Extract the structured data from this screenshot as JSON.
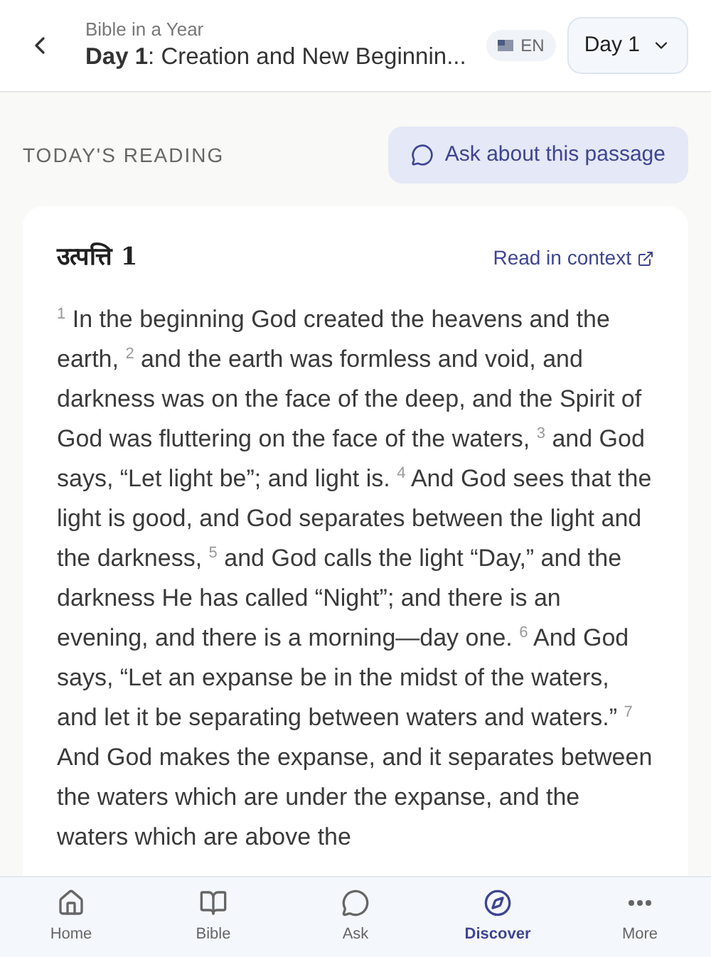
{
  "header": {
    "subtitle": "Bible in a Year",
    "title_bold": "Day 1",
    "title_rest": ": Creation and New Beginnin...",
    "language": "EN",
    "day_select": "Day 1"
  },
  "section": {
    "heading": "TODAY'S READING",
    "ask_button": "Ask about this passage"
  },
  "reading": {
    "title": "उत्पत्ति 1",
    "link": "Read in context",
    "passage": "$^{1}$ In the beginning God created the heavens and the earth, $^{2}$ and the earth was formless and void, and darkness was on the face of the deep, and the Spirit of God was fluttering on the face of the waters, $^{3}$ and God says, “Let light be”; and light is. $^{4}$ And God sees that the light is good, and God separates between the light and the darkness, $^{5}$ and God calls the light “Day,” and the darkness He has called “Night”; and there is an evening, and there is a morning—day one. $^{6}$ And God says, “Let an expanse be in the midst of the waters, and let it be separating between waters and waters.” $^{7}$ And God makes the expanse, and it separates between the waters which are under the expanse, and the waters which are above the"
  },
  "nav": [
    {
      "label": "Home",
      "kind": "home",
      "selected": false
    },
    {
      "label": "Bible",
      "kind": "bible",
      "selected": false
    },
    {
      "label": "Ask",
      "kind": "ask",
      "selected": false
    },
    {
      "label": "Discover",
      "kind": "discover",
      "selected": true
    },
    {
      "label": "More",
      "kind": "more",
      "selected": false
    }
  ]
}
